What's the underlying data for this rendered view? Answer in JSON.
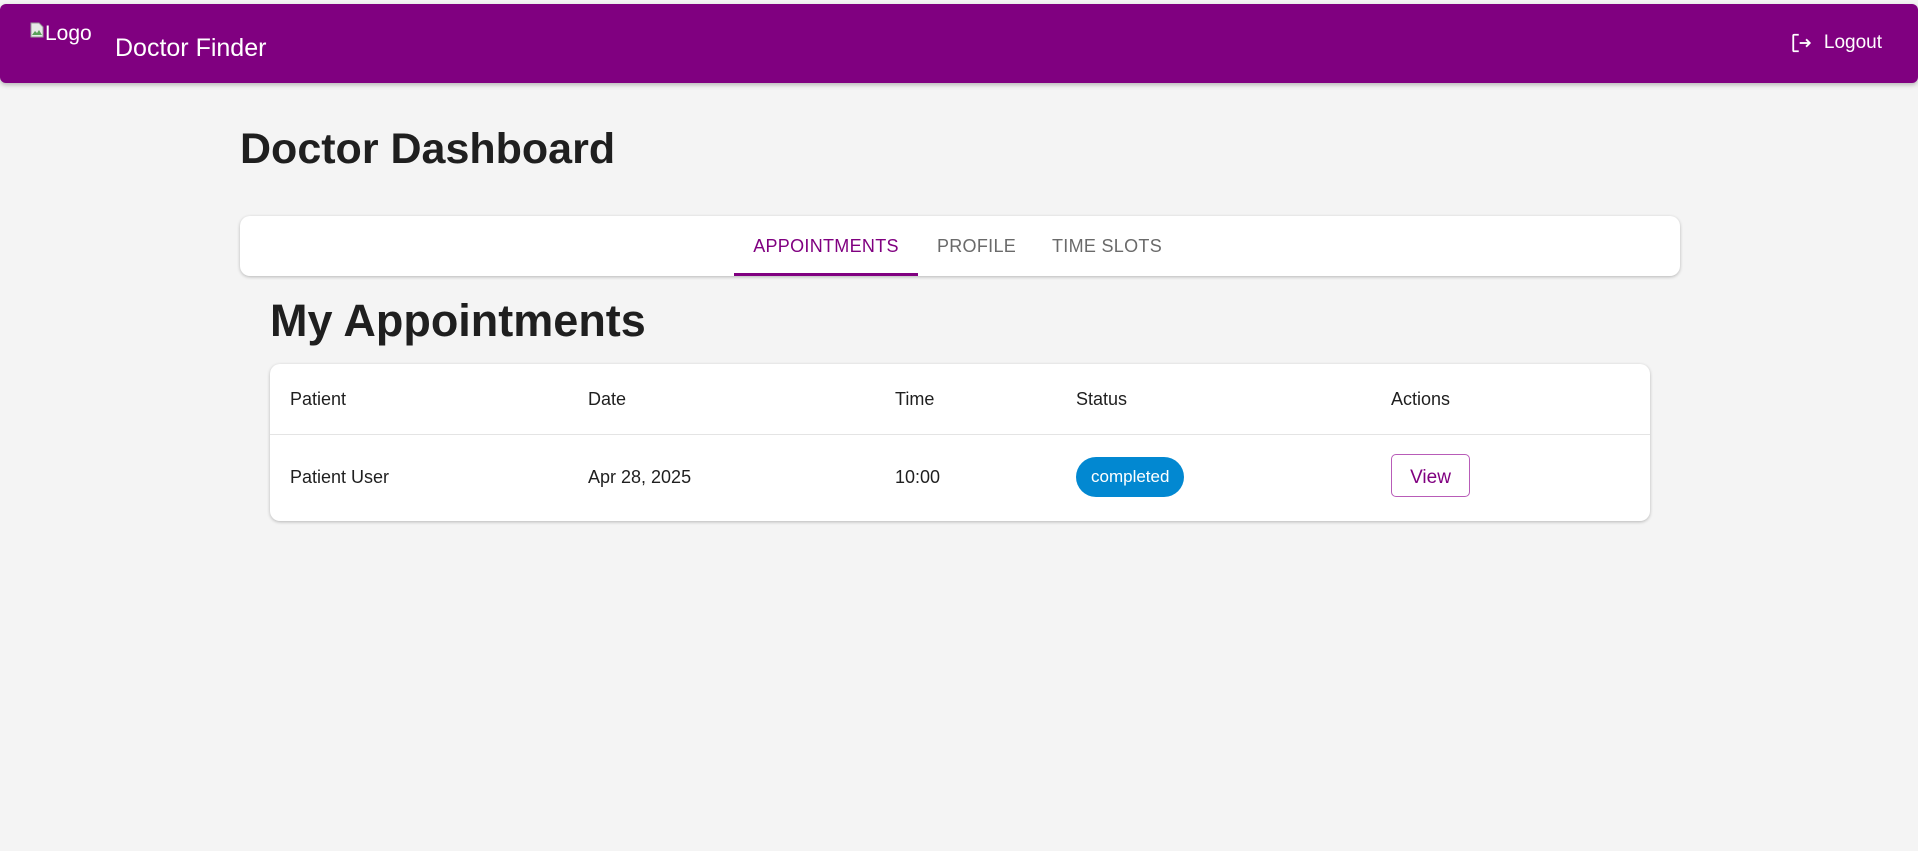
{
  "header": {
    "logo_alt": "Logo",
    "title": "Doctor Finder",
    "logout_label": "Logout"
  },
  "page": {
    "title": "Doctor Dashboard"
  },
  "tabs": [
    {
      "label": "APPOINTMENTS",
      "active": true
    },
    {
      "label": "PROFILE",
      "active": false
    },
    {
      "label": "TIME SLOTS",
      "active": false
    }
  ],
  "appointments": {
    "title": "My Appointments",
    "columns": [
      "Patient",
      "Date",
      "Time",
      "Status",
      "Actions"
    ],
    "rows": [
      {
        "patient": "Patient User",
        "date": "Apr 28, 2025",
        "time": "10:00",
        "status": "completed",
        "action": "View"
      }
    ]
  },
  "colors": {
    "brand": "#800080",
    "status_completed": "#0288d1",
    "background": "#f4f4f4"
  }
}
